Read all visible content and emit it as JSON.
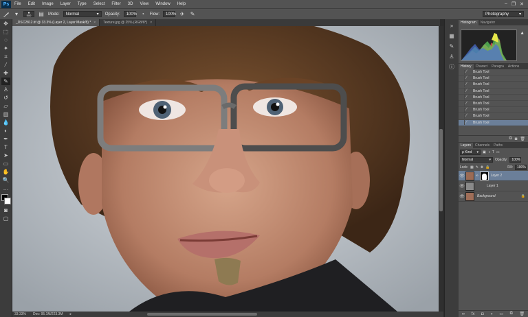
{
  "app": {
    "logo": "Ps"
  },
  "menu": [
    "File",
    "Edit",
    "Image",
    "Layer",
    "Type",
    "Select",
    "Filter",
    "3D",
    "View",
    "Window",
    "Help"
  ],
  "window_controls": {
    "minimize": "–",
    "restore": "❐",
    "close": "✕"
  },
  "options": {
    "brush_size": "500",
    "mode_label": "Mode:",
    "mode_value": "Normal",
    "opacity_label": "Opacity:",
    "opacity_value": "100%",
    "flow_label": "Flow:",
    "flow_value": "100%",
    "workspace": "Photography"
  },
  "tabs": [
    {
      "label": "_DSC2812.tif @ 33.3% (Layer 2, Layer Mask/8) *",
      "close": "×"
    },
    {
      "label": "Texture.jpg @ 25% (RGB/8*)",
      "close": "×"
    }
  ],
  "status": {
    "zoom": "33.33%",
    "doc": "Doc: 95.1M/223.3M"
  },
  "histogram": {
    "tabs": [
      "Histogram",
      "Navigator"
    ]
  },
  "history": {
    "tabs": [
      "History",
      "Charact",
      "Paragra",
      "Actions"
    ],
    "items": [
      "Brush Tool",
      "Brush Tool",
      "Brush Tool",
      "Brush Tool",
      "Brush Tool",
      "Brush Tool",
      "Brush Tool",
      "Brush Tool",
      "Brush Tool"
    ]
  },
  "layers_panel": {
    "tabs": [
      "Layers",
      "Channels",
      "Paths"
    ],
    "kind_label": "ρ Kind",
    "blend_mode": "Normal",
    "opacity_label": "Opacity:",
    "opacity_value": "100%",
    "lock_label": "Lock:",
    "fill_label": "Fill:",
    "fill_value": "100%",
    "layers": [
      {
        "name": "Layer 2",
        "active": true
      },
      {
        "name": "Layer 1",
        "active": false
      },
      {
        "name": "Background",
        "active": false
      }
    ]
  },
  "colors": {
    "accent_selection": "#6b7f99",
    "chrome": "#535353"
  }
}
